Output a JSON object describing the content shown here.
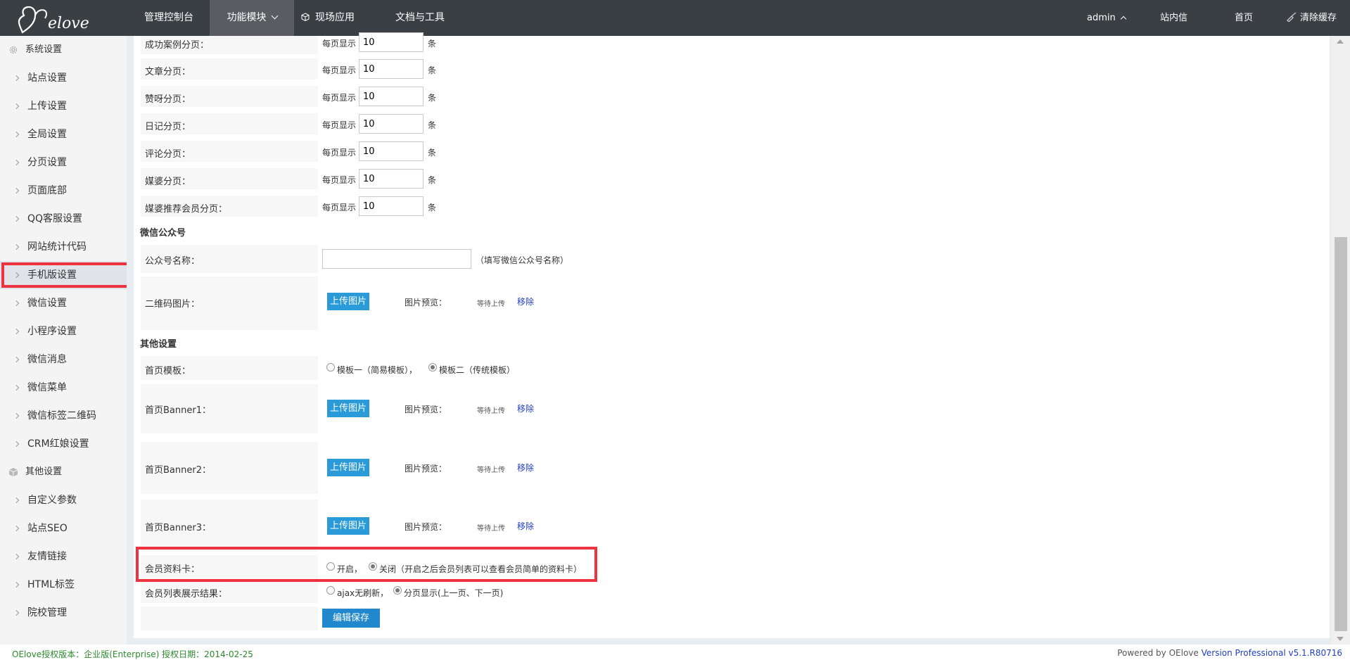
{
  "topnav": {
    "items": [
      "管理控制台",
      "功能模块",
      "现场应用",
      "文档与工具"
    ],
    "user": "admin",
    "links": [
      "站内信",
      "首页",
      "清除缓存"
    ]
  },
  "sidebar": {
    "groups": [
      "系统设置",
      "其他设置"
    ],
    "system_items": [
      "站点设置",
      "上传设置",
      "全局设置",
      "分页设置",
      "页面底部",
      "QQ客服设置",
      "网站统计代码",
      "手机版设置",
      "微信设置",
      "小程序设置",
      "微信消息",
      "微信菜单",
      "微信标签二维码",
      "CRM红娘设置"
    ],
    "other_items": [
      "自定义参数",
      "站点SEO",
      "友情链接",
      "HTML标签",
      "院校管理"
    ],
    "active_item": "手机版设置"
  },
  "pagination": {
    "prefix": "每页显示",
    "suffix": "条",
    "rows": [
      {
        "label": "成功案例分页：",
        "value": "10"
      },
      {
        "label": "文章分页：",
        "value": "10"
      },
      {
        "label": "赞呀分页：",
        "value": "10"
      },
      {
        "label": "日记分页：",
        "value": "10"
      },
      {
        "label": "评论分页：",
        "value": "10"
      },
      {
        "label": "媒婆分页：",
        "value": "10"
      },
      {
        "label": "媒婆推荐会员分页：",
        "value": "10"
      }
    ]
  },
  "wechat": {
    "title": "微信公众号",
    "name_label": "公众号名称：",
    "name_value": "",
    "name_hint": "（填写微信公众号名称）",
    "qr_label": "二维码图片："
  },
  "upload": {
    "button": "上传图片",
    "preview_label": "图片预览：",
    "pending": "等待上传",
    "remove": "移除"
  },
  "other": {
    "title": "其他设置",
    "template_label": "首页模板：",
    "template_options": [
      "模板一（简易模板），",
      "模板二（传统模板）"
    ],
    "template_selected": 1,
    "banner_labels": [
      "首页Banner1：",
      "首页Banner2：",
      "首页Banner3："
    ],
    "card_label": "会员资料卡：",
    "card_options": [
      "开启，",
      "关闭（开启之后会员列表可以查看会员简单的资料卡）"
    ],
    "card_selected": 1,
    "list_label": "会员列表展示结果：",
    "list_options": [
      "ajax无刷新，",
      "分页显示(上一页、下一页)"
    ],
    "list_selected": 1,
    "save_button": "编辑保存"
  },
  "footer": {
    "left": "OElove授权版本：企业版(Enterprise) 授权日期：2014-02-25",
    "right_prefix": "Powered by OElove",
    "right_version": "Version Professional v5.1.R80716"
  },
  "colors": {
    "topbar": "#3a3f44",
    "accent_blue": "#2a9bd8",
    "highlight_red": "#ee3240"
  }
}
